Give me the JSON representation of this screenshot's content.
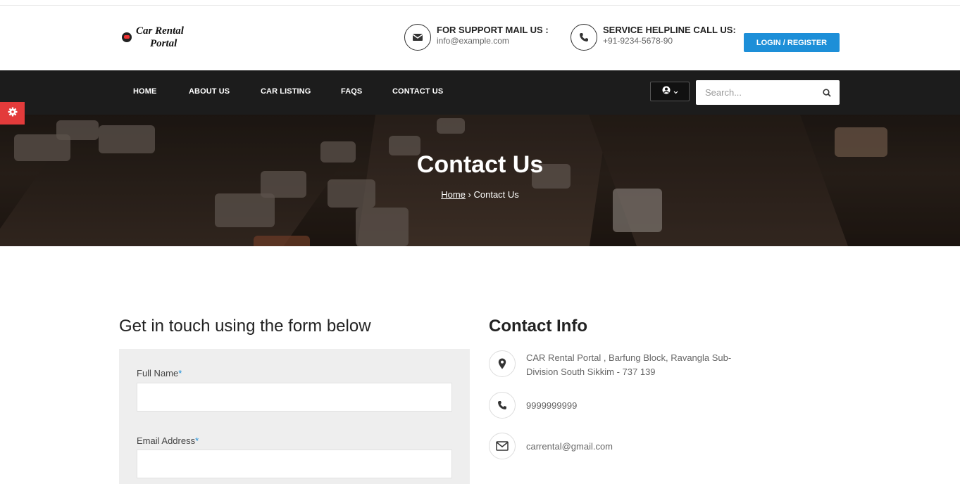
{
  "header": {
    "logo_line1": "Car Rental",
    "logo_line2": "Portal",
    "support_title": "FOR SUPPORT MAIL US :",
    "support_value": "info@example.com",
    "helpline_title": "SERVICE HELPLINE CALL US:",
    "helpline_value": "+91-9234-5678-90",
    "login_label": "LOGIN / REGISTER"
  },
  "nav": {
    "items": [
      {
        "label": "HOME"
      },
      {
        "label": "ABOUT US"
      },
      {
        "label": "CAR LISTING"
      },
      {
        "label": "FAQS"
      },
      {
        "label": "CONTACT US"
      }
    ],
    "search_placeholder": "Search..."
  },
  "banner": {
    "title": "Contact Us",
    "breadcrumb_home": "Home",
    "breadcrumb_separator": "›",
    "breadcrumb_current": "Contact Us"
  },
  "form": {
    "heading": "Get in touch using the form below",
    "full_name_label": "Full Name",
    "email_label": "Email Address",
    "required_mark": "*"
  },
  "contact_info": {
    "heading": "Contact Info",
    "address_line1": "CAR Rental Portal , Barfung Block, Ravangla Sub-",
    "address_line2": "Division South Sikkim - 737 139",
    "phone": "9999999999",
    "email": "carrental@gmail.com"
  },
  "colors": {
    "accent": "#1d8fd8",
    "nav_bg": "#1c1c1c",
    "gear_tab": "#e33b3b"
  },
  "icons": [
    "envelope-icon",
    "phone-icon",
    "user-icon",
    "chevron-down-icon",
    "search-icon",
    "gear-icon",
    "map-marker-icon",
    "envelope-outline-icon"
  ]
}
